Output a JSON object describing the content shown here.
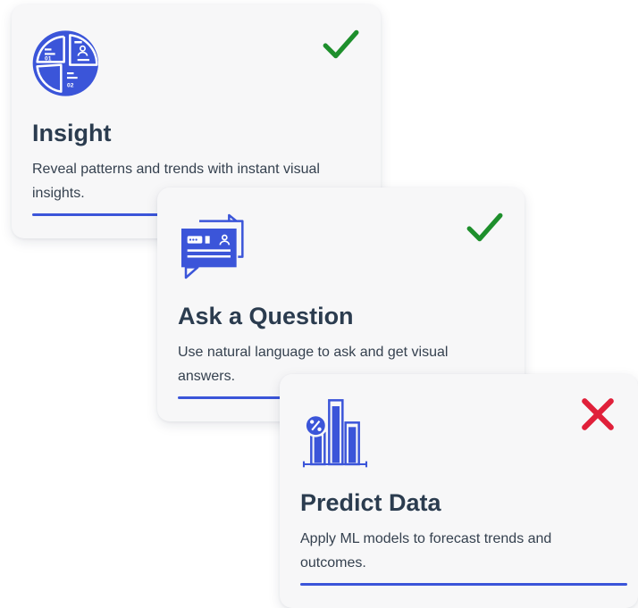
{
  "colors": {
    "accent": "#3b55d9",
    "check": "#1e8f2c",
    "cross": "#e0203a",
    "title": "#2b3c4f",
    "text": "#35414f",
    "card_bg": "#f7f7f8"
  },
  "cards": [
    {
      "title": "Insight",
      "description": "Reveal patterns and trends with instant visual insights.",
      "icon": "pie-chart-icon",
      "icon_labels": [
        "01",
        "02"
      ],
      "status": "check-icon"
    },
    {
      "title": "Ask a Question",
      "description": "Use natural language to ask and get visual answers.",
      "icon": "chat-question-icon",
      "status": "check-icon"
    },
    {
      "title": "Predict Data",
      "description": "Apply ML models to forecast trends and outcomes.",
      "icon": "bar-chart-percent-icon",
      "status": "cross-icon"
    }
  ]
}
